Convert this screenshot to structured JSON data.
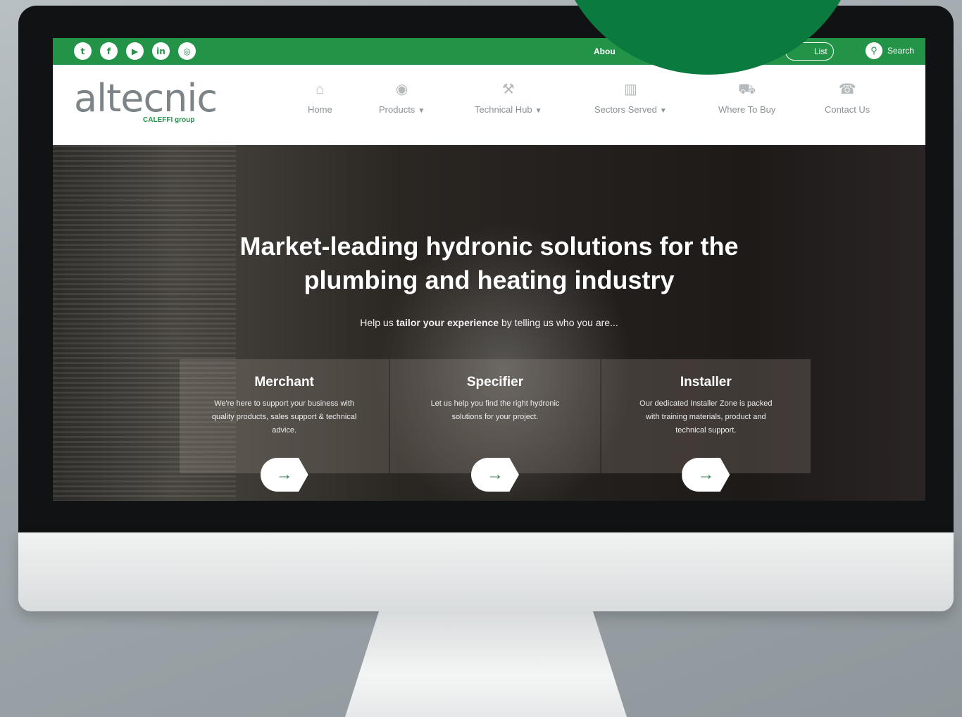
{
  "topbar": {
    "social": [
      {
        "icon": "twitter-icon",
        "glyph": "t"
      },
      {
        "icon": "facebook-icon",
        "glyph": "f"
      },
      {
        "icon": "youtube-icon",
        "glyph": "▶"
      },
      {
        "icon": "linkedin-icon",
        "glyph": "in"
      },
      {
        "icon": "instagram-icon",
        "glyph": "◎"
      }
    ],
    "about_label": "Abou",
    "list_label": "List",
    "search_label": "Search",
    "brand_color": "#239447"
  },
  "logo": {
    "wordmark": "altecnic",
    "subtitle": "CALEFFI group"
  },
  "nav": [
    {
      "icon": "home-icon",
      "glyph": "⌂",
      "label": "Home",
      "has_dropdown": false
    },
    {
      "icon": "products-icon",
      "glyph": "◉",
      "label": "Products",
      "has_dropdown": true
    },
    {
      "icon": "wrench-icon",
      "glyph": "⚒",
      "label": "Technical Hub",
      "has_dropdown": true
    },
    {
      "icon": "building-icon",
      "glyph": "▥",
      "label": "Sectors Served",
      "has_dropdown": true
    },
    {
      "icon": "cart-icon",
      "glyph": "⛟",
      "label": "Where To Buy",
      "has_dropdown": false
    },
    {
      "icon": "contact-icon",
      "glyph": "☎",
      "label": "Contact Us",
      "has_dropdown": false
    }
  ],
  "hero": {
    "title_line1": "Market-leading hydronic solutions for the",
    "title_line2": "plumbing and heating industry",
    "sub_prefix": "Help us ",
    "sub_bold": "tailor your experience",
    "sub_suffix": " by telling us who you are..."
  },
  "cards": [
    {
      "title": "Merchant",
      "text": "We're here to support your business with quality products, sales support & technical advice."
    },
    {
      "title": "Specifier",
      "text": "Let us help you find the right hydronic solutions for your project."
    },
    {
      "title": "Installer",
      "text": "Our dedicated Installer Zone is packed with training materials, product and technical support."
    }
  ]
}
